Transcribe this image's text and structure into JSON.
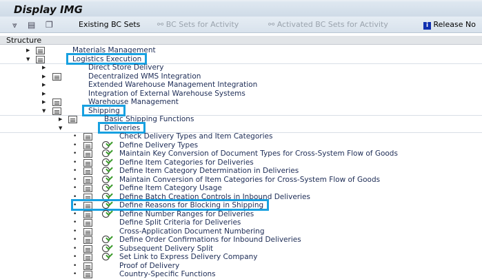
{
  "title": "Display IMG",
  "toolbar": {
    "existing": "Existing BC Sets",
    "bc_activity": "BC Sets for Activity",
    "activated": "Activated BC Sets for Activity",
    "release": "Release No"
  },
  "structure_header": "Structure",
  "tree": [
    {
      "label": "Materials Management",
      "level": 1,
      "state": "collapsed",
      "doc": true,
      "clock": false
    },
    {
      "label": "Logistics Execution",
      "level": 1,
      "state": "expanded",
      "doc": true,
      "clock": false,
      "highlight": true
    },
    {
      "label": "Direct Store Delivery",
      "level": 2,
      "state": "collapsed",
      "doc": false,
      "clock": false
    },
    {
      "label": "Decentralized WMS Integration",
      "level": 2,
      "state": "collapsed",
      "doc": true,
      "clock": false
    },
    {
      "label": "Extended Warehouse Management Integration",
      "level": 2,
      "state": "collapsed",
      "doc": false,
      "clock": false
    },
    {
      "label": "Integration of External Warehouse Systems",
      "level": 2,
      "state": "collapsed",
      "doc": false,
      "clock": false
    },
    {
      "label": "Warehouse Management",
      "level": 2,
      "state": "collapsed",
      "doc": true,
      "clock": false
    },
    {
      "label": "Shipping",
      "level": 2,
      "state": "expanded",
      "doc": true,
      "clock": false,
      "highlight": true
    },
    {
      "label": "Basic Shipping Functions",
      "level": 3,
      "state": "collapsed",
      "doc": true,
      "clock": false
    },
    {
      "label": "Deliveries",
      "level": 3,
      "state": "expanded",
      "doc": false,
      "clock": false,
      "highlight": true
    },
    {
      "label": "Check Delivery Types and Item Categories",
      "level": 4,
      "state": "leaf",
      "doc": true,
      "clock": false
    },
    {
      "label": "Define Delivery Types",
      "level": 4,
      "state": "leaf",
      "doc": true,
      "clock": true
    },
    {
      "label": "Maintain Key Conversion of Document Types for Cross-System Flow of Goods",
      "level": 4,
      "state": "leaf",
      "doc": true,
      "clock": true
    },
    {
      "label": "Define Item Categories for Deliveries",
      "level": 4,
      "state": "leaf",
      "doc": true,
      "clock": true
    },
    {
      "label": "Define Item Category Determination in Deliveries",
      "level": 4,
      "state": "leaf",
      "doc": true,
      "clock": true
    },
    {
      "label": "Maintain Conversion of Item Categories for Cross-System Flow of Goods",
      "level": 4,
      "state": "leaf",
      "doc": true,
      "clock": true
    },
    {
      "label": "Define Item Category Usage",
      "level": 4,
      "state": "leaf",
      "doc": true,
      "clock": true
    },
    {
      "label": "Define Batch Creation Controls in Inbound Deliveries",
      "level": 4,
      "state": "leaf",
      "doc": true,
      "clock": true
    },
    {
      "label": "Define Reasons for Blocking in Shipping",
      "level": 4,
      "state": "leaf",
      "doc": true,
      "clock": true,
      "highlight": true
    },
    {
      "label": "Define Number Ranges for Deliveries",
      "level": 4,
      "state": "leaf",
      "doc": true,
      "clock": true
    },
    {
      "label": "Define Split Criteria for Deliveries",
      "level": 4,
      "state": "leaf",
      "doc": true,
      "clock": false
    },
    {
      "label": "Cross-Application Document Numbering",
      "level": 4,
      "state": "leaf",
      "doc": true,
      "clock": false
    },
    {
      "label": "Define Order Confirmations for Inbound Deliveries",
      "level": 4,
      "state": "leaf",
      "doc": true,
      "clock": true
    },
    {
      "label": "Subsequent Delivery Split",
      "level": 4,
      "state": "leaf",
      "doc": true,
      "clock": true
    },
    {
      "label": "Set Link to Express Delivery Company",
      "level": 4,
      "state": "leaf",
      "doc": true,
      "clock": true
    },
    {
      "label": "Proof of Delivery",
      "level": 4,
      "state": "leaf",
      "doc": true,
      "clock": false
    },
    {
      "label": "Country-Specific Functions",
      "level": 4,
      "state": "leaf",
      "doc": true,
      "clock": false
    }
  ],
  "colors": {
    "highlight": "#17a0e0",
    "text": "#1c2b55"
  }
}
